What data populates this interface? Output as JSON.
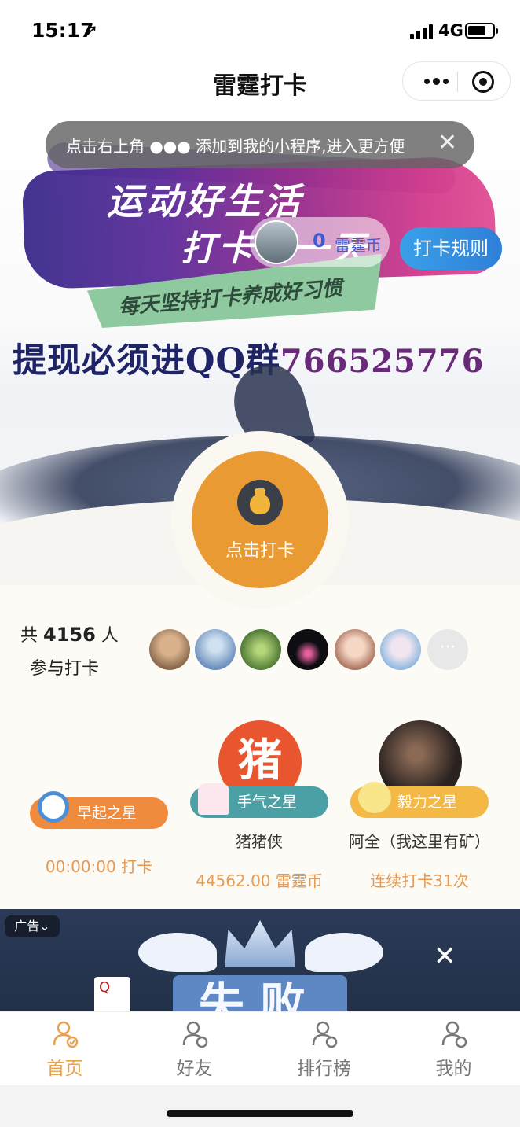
{
  "status_bar": {
    "time": "15:17",
    "network": "4G"
  },
  "nav": {
    "title": "雷霆打卡"
  },
  "toast": {
    "text": "点击右上角 ●●● 添加到我的小程序,进入更方便",
    "close": "✕"
  },
  "banner": {
    "slogan_main_1": "运动好生活",
    "slogan_main_2": "打卡每一天",
    "slogan_sub": "每天坚持打卡养成好习惯",
    "qq_text": "提现必须进QQ群",
    "qq_number": "766525776",
    "coin_count": "0",
    "coin_unit": "雷霆币",
    "rules_button": "打卡规则"
  },
  "checkin": {
    "label": "点击打卡"
  },
  "participants": {
    "prefix": "共",
    "count": "4156",
    "suffix": "人",
    "label": "参与打卡",
    "more": "···"
  },
  "stars": [
    {
      "badge": "早起之星",
      "name": "",
      "value": "00:00:00 打卡",
      "badge_color": "#f08a3c"
    },
    {
      "badge": "手气之星",
      "name": "猪猪侠",
      "value": "44562.00 雷霆币",
      "badge_color": "#4aa0a4",
      "photo_text": "猪"
    },
    {
      "badge": "毅力之星",
      "name": "阿全（我这里有矿）",
      "value": "连续打卡31次",
      "badge_color": "#f3b845"
    }
  ],
  "ad": {
    "label": "广告⌄",
    "headline": "失败",
    "card": "Q",
    "close": "✕"
  },
  "tabs": [
    {
      "label": "首页",
      "active": true
    },
    {
      "label": "好友",
      "active": false
    },
    {
      "label": "排行榜",
      "active": false
    },
    {
      "label": "我的",
      "active": false
    }
  ],
  "colors": {
    "accent": "#e8a14a",
    "checkin": "#e99a32",
    "rules": "#3a8fe0"
  }
}
